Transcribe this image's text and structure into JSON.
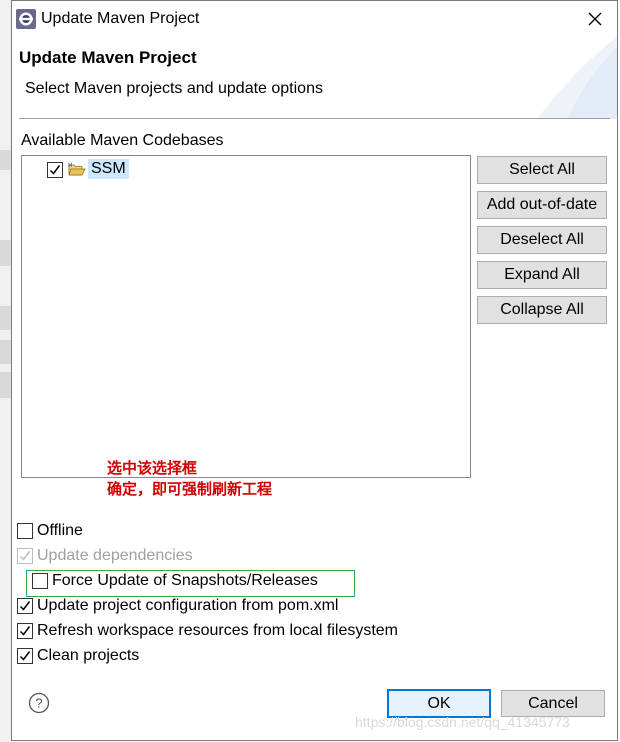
{
  "window": {
    "title": "Update Maven Project",
    "close_icon": "close-icon"
  },
  "header": {
    "title": "Update Maven Project",
    "subtitle": "Select Maven projects and update options"
  },
  "codebases": {
    "label": "Available Maven Codebases",
    "items": [
      {
        "name": "SSM",
        "checked": true,
        "icon": "maven-folder-icon"
      }
    ]
  },
  "buttons": {
    "select_all": "Select All",
    "add_out_of_date": "Add out-of-date",
    "deselect_all": "Deselect All",
    "expand_all": "Expand All",
    "collapse_all": "Collapse All"
  },
  "annotation": {
    "line1": "选中该选择框",
    "line2": "确定，即可强制刷新工程",
    "color": "#d00000",
    "box_color": "#2eaa4a"
  },
  "options": {
    "offline": {
      "label": "Offline",
      "checked": false,
      "enabled": true
    },
    "update_dependencies": {
      "label": "Update dependencies",
      "checked": true,
      "enabled": false
    },
    "force_update": {
      "label": "Force Update of Snapshots/Releases",
      "checked": false,
      "enabled": true
    },
    "update_config": {
      "label": "Update project configuration from pom.xml",
      "checked": true,
      "enabled": true
    },
    "refresh_workspace": {
      "label": "Refresh workspace resources from local filesystem",
      "checked": true,
      "enabled": true
    },
    "clean_projects": {
      "label": "Clean projects",
      "checked": true,
      "enabled": true
    }
  },
  "footer": {
    "ok": "OK",
    "cancel": "Cancel",
    "help_icon": "help-icon"
  },
  "watermark": "https://blog.csdn.net/qq_41345773",
  "colors": {
    "ok_border": "#0078d7",
    "button_bg": "#e1e1e1"
  }
}
